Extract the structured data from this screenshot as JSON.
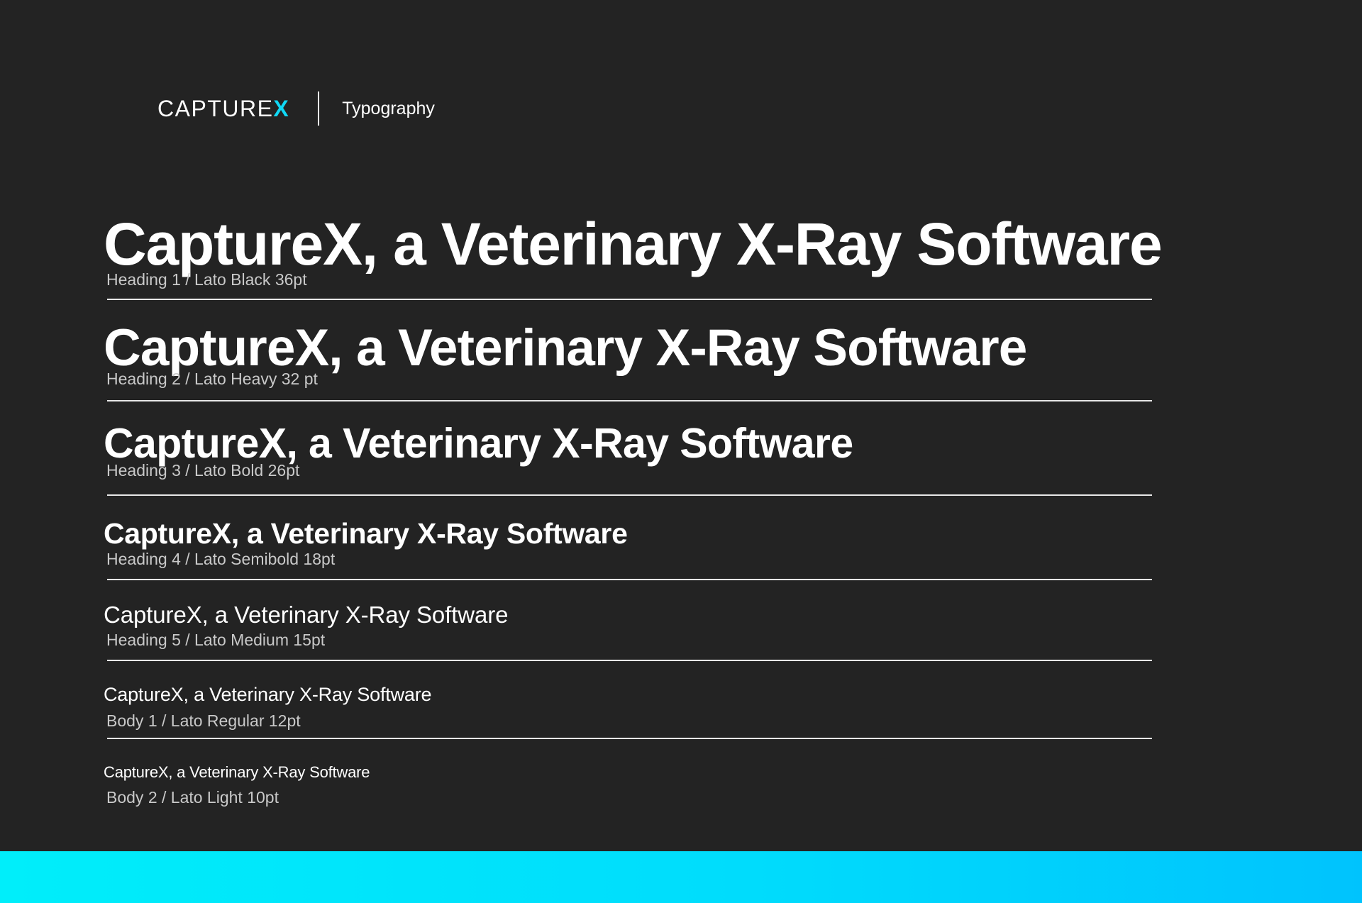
{
  "header": {
    "logo_text": "CAPTURE",
    "logo_accent": "X",
    "section_label": "Typography"
  },
  "specimens": [
    {
      "sample": "CaptureX, a Veterinary X-Ray Software",
      "caption": "Heading 1 / Lato Black 36pt"
    },
    {
      "sample": "CaptureX, a Veterinary X-Ray Software",
      "caption": "Heading 2 / Lato Heavy 32 pt"
    },
    {
      "sample": "CaptureX, a Veterinary X-Ray Software",
      "caption": "Heading 3 / Lato Bold 26pt"
    },
    {
      "sample": "CaptureX, a Veterinary X-Ray Software",
      "caption": "Heading 4 / Lato Semibold 18pt"
    },
    {
      "sample": "CaptureX, a Veterinary X-Ray Software",
      "caption": "Heading 5 / Lato Medium 15pt"
    },
    {
      "sample": "CaptureX, a Veterinary X-Ray Software",
      "caption": "Body 1 / Lato Regular 12pt"
    },
    {
      "sample": "CaptureX, a Veterinary X-Ray Software",
      "caption": "Body 2 / Lato Light 10pt"
    }
  ],
  "colors": {
    "background": "#232323",
    "text": "#ffffff",
    "caption": "#c9c9c9",
    "accent": "#10d8f5",
    "footer_gradient_start": "#00eefa",
    "footer_gradient_end": "#00c3fd"
  }
}
